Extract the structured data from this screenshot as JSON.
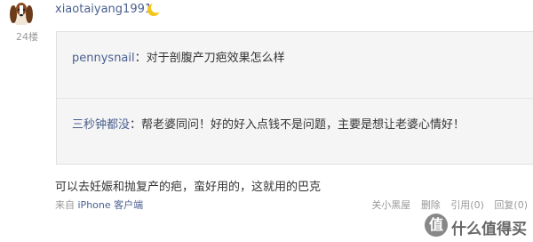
{
  "post": {
    "username": "xiaotaiyang1991",
    "floor": "24楼",
    "moon_icon": "moon-icon",
    "quote": {
      "line1_user": "pennysnail",
      "line1_sep": "：",
      "line1_text": "对于剖腹产刀疤效果怎么样",
      "line2_user": "三秒钟都没",
      "line2_sep": "：",
      "line2_text": "帮老婆同问！好的好入点钱不是问题，主要是想让老婆心情好！"
    },
    "reply_text": "可以去妊娠和抛复产的疤，蛮好用的，这就用的巴克",
    "source_prefix": "来自 ",
    "source_device": "iPhone 客户端",
    "actions": {
      "block": "关小黑屋",
      "delete": "删除",
      "quote": "引用(0)",
      "reply": "回复(0)"
    }
  },
  "watermark": {
    "icon_char": "值",
    "text": "什么值得买"
  },
  "colors": {
    "link": "#4a5f8f",
    "muted": "#999999",
    "quote_bg": "#f5f5f5"
  }
}
